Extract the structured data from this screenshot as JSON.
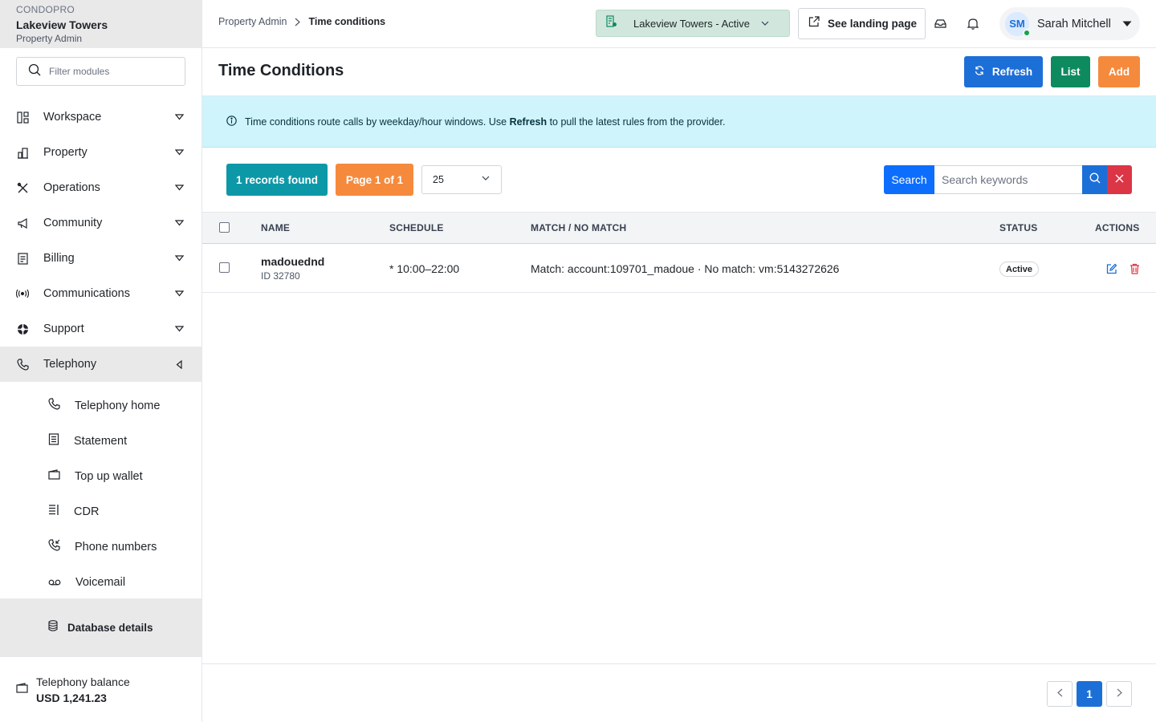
{
  "brand": {
    "kicker": "CONDOPRO",
    "org": "Lakeview Towers",
    "role": "Property Admin"
  },
  "sidebar": {
    "filter_placeholder": "Filter modules",
    "items": [
      {
        "label": "Workspace",
        "icon": "workspace-icon"
      },
      {
        "label": "Property",
        "icon": "building-icon"
      },
      {
        "label": "Operations",
        "icon": "tools-icon"
      },
      {
        "label": "Community",
        "icon": "megaphone-icon"
      },
      {
        "label": "Billing",
        "icon": "receipt-icon"
      },
      {
        "label": "Communications",
        "icon": "broadcast-icon"
      },
      {
        "label": "Support",
        "icon": "lifebuoy-icon"
      },
      {
        "label": "Telephony",
        "icon": "phone-icon"
      }
    ],
    "telephony_sub": [
      {
        "label": "Telephony home",
        "icon": "phone-icon"
      },
      {
        "label": "Statement",
        "icon": "document-icon"
      },
      {
        "label": "Top up wallet",
        "icon": "wallet-icon"
      },
      {
        "label": "CDR",
        "icon": "list-icon"
      },
      {
        "label": "Phone numbers",
        "icon": "phone-incoming-icon"
      },
      {
        "label": "Voicemail",
        "icon": "voicemail-icon"
      }
    ],
    "database_details": "Database details",
    "balance_label": "Telephony balance",
    "balance_value": "USD 1,241.23"
  },
  "topbar": {
    "breadcrumb_parent": "Property Admin",
    "breadcrumb_current": "Time conditions",
    "property_selector": "Lakeview Towers - Active",
    "landing_page": "See landing page",
    "user_initials": "SM",
    "user_name": "Sarah Mitchell"
  },
  "page": {
    "title": "Time Conditions",
    "refresh": "Refresh",
    "list": "List",
    "add": "Add"
  },
  "info": {
    "before": "Time conditions route calls by weekday/hour windows. Use ",
    "bold": "Refresh",
    "after": " to pull the latest rules from the provider."
  },
  "toolbar": {
    "records": "1 records found",
    "page": "Page 1 of 1",
    "per_page": "25",
    "search_label": "Search",
    "search_placeholder": "Search keywords"
  },
  "table": {
    "headers": {
      "name": "NAME",
      "schedule": "SCHEDULE",
      "match": "MATCH / NO MATCH",
      "status": "STATUS",
      "actions": "ACTIONS"
    },
    "rows": [
      {
        "name": "madouednd",
        "id": "ID 32780",
        "schedule": "* 10:00–22:00",
        "match": "Match: account:109701_madoue · No match: vm:5143272626",
        "status": "Active"
      }
    ]
  },
  "pagination": {
    "current": "1"
  },
  "colors": {
    "primary": "#1d6fd8",
    "success": "#0e8a5f",
    "warning": "#f58a3d",
    "info": "#0d98a8",
    "danger": "#dc3545",
    "info_bg": "#cff4fc"
  }
}
